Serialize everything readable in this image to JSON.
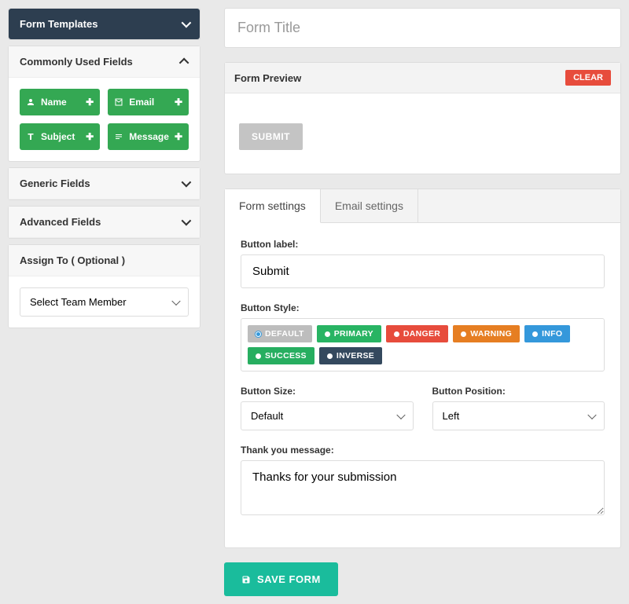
{
  "sidebar": {
    "templates_title": "Form Templates",
    "common_title": "Commonly Used Fields",
    "common_fields": [
      {
        "label": "Name",
        "icon": "user"
      },
      {
        "label": "Email",
        "icon": "mail"
      },
      {
        "label": "Subject",
        "icon": "text"
      },
      {
        "label": "Message",
        "icon": "lines"
      }
    ],
    "generic_title": "Generic Fields",
    "advanced_title": "Advanced Fields",
    "assign_title": "Assign To ( Optional )",
    "assign_placeholder": "Select Team Member"
  },
  "main": {
    "title_placeholder": "Form Title",
    "preview_label": "Form Preview",
    "clear_label": "CLEAR",
    "submit_preview": "SUBMIT"
  },
  "tabs": {
    "form": "Form settings",
    "email": "Email settings"
  },
  "settings": {
    "button_label_label": "Button label:",
    "button_label_value": "Submit",
    "button_style_label": "Button Style:",
    "styles": [
      {
        "label": "DEFAULT",
        "cls": "c-default",
        "selected": true
      },
      {
        "label": "PRIMARY",
        "cls": "c-primary"
      },
      {
        "label": "DANGER",
        "cls": "c-danger"
      },
      {
        "label": "WARNING",
        "cls": "c-warning"
      },
      {
        "label": "INFO",
        "cls": "c-info"
      },
      {
        "label": "SUCCESS",
        "cls": "c-success"
      },
      {
        "label": "INVERSE",
        "cls": "c-inverse"
      }
    ],
    "button_size_label": "Button Size:",
    "button_size_value": "Default",
    "button_position_label": "Button Position:",
    "button_position_value": "Left",
    "thankyou_label": "Thank you message:",
    "thankyou_value": "Thanks for your submission"
  },
  "save_label": "SAVE FORM"
}
